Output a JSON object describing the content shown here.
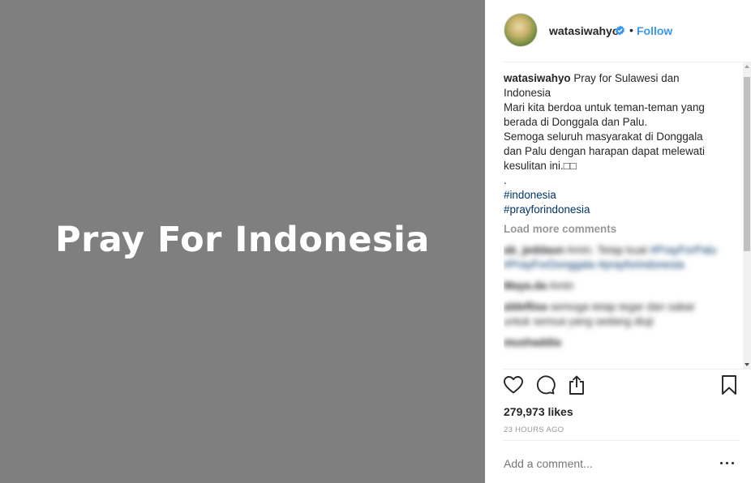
{
  "post_image": {
    "text": "Pray For Indonesia"
  },
  "header": {
    "username": "watasiwahyo",
    "separator": "•",
    "follow_label": "Follow",
    "icons": [
      "avatar",
      "verified-badge-icon"
    ]
  },
  "caption": {
    "username": "watasiwahyo",
    "lines": [
      "Pray for Sulawesi dan Indonesia",
      "Mari kita berdoa untuk teman-teman yang berada di Donggala dan Palu.",
      "Semoga seluruh masyarakat di Donggala dan Palu dengan harapan dapat melewati kesulitan ini.□□",
      "."
    ],
    "hashtags": [
      "#indonesia",
      "#prayforindonesia"
    ]
  },
  "load_more_label": "Load more comments",
  "blurred_comments": [
    {
      "user": "ab_jeddaun",
      "text": "Amin. Tetap kuat",
      "tags": "#PrayForPalu #PrayForDonggala #prayforindonesia"
    },
    {
      "user": "Maya.da",
      "text": "Amin"
    },
    {
      "user": "aldeflisa",
      "text": "semoga tetap tegar dan sabar untuk semua yang sedang diuji"
    },
    {
      "user": "mushaddia",
      "text": ""
    }
  ],
  "actions": {
    "icons": [
      "heart-icon",
      "comment-icon",
      "share-icon",
      "bookmark-icon"
    ]
  },
  "likes_text": "279,973 likes",
  "timestamp": "23 HOURS AGO",
  "add_comment_placeholder": "Add a comment...",
  "colors": {
    "link": "#3897f0",
    "hashtag": "#003569",
    "muted": "#999999",
    "image_bg": "#7f7f7f"
  }
}
